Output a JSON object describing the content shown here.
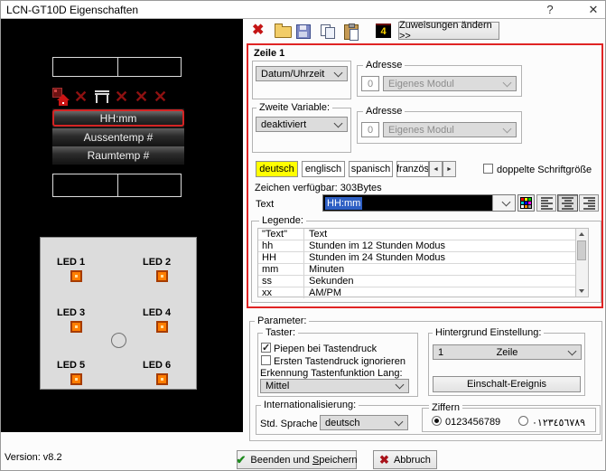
{
  "window": {
    "title": "LCN-GT10D Eigenschaften",
    "help_glyph": "?",
    "close_glyph": "✕"
  },
  "toolbar": {
    "four_label": "4",
    "assign_button": "Zuweisungen ändern >>",
    "icons": [
      "delete-icon",
      "open-icon",
      "save-icon",
      "copy-icon",
      "paste-icon",
      "display-page-icon"
    ]
  },
  "preview": {
    "lines": [
      "HH:mm",
      "Aussentemp #",
      "Raumtemp #"
    ],
    "selected_line": "HH:mm",
    "icons": [
      "module-home-icon",
      "cross-icon",
      "table-icon",
      "cross-icon",
      "cross-icon",
      "cross-icon"
    ],
    "leds": [
      "LED 1",
      "LED 2",
      "LED 3",
      "LED 4",
      "LED 5",
      "LED 6"
    ]
  },
  "zeile1": {
    "title": "Zeile 1",
    "variable1": "Datum/Uhrzeit",
    "adresse1": {
      "label": "Adresse",
      "id": "0",
      "module": "Eigenes Modul"
    },
    "zweite_variable_label": "Zweite Variable:",
    "variable2": "deaktiviert",
    "adresse2": {
      "label": "Adresse",
      "id": "0",
      "module": "Eigenes Modul"
    },
    "tabs": [
      "deutsch",
      "englisch",
      "spanisch",
      "französ"
    ],
    "active_tab": "deutsch",
    "tab_scroll_left": "◄",
    "tab_scroll_right": "►",
    "double_size_label": "doppelte Schriftgröße",
    "double_size_checked": false,
    "chars_available": "Zeichen verfügbar: 303Bytes",
    "text_label": "Text",
    "text_value": "HH:mm",
    "legend": {
      "title": "Legende:",
      "rows": [
        [
          "\"Text\"",
          "Text"
        ],
        [
          "hh",
          "Stunden im 12 Stunden Modus"
        ],
        [
          "HH",
          "Stunden im 24 Stunden Modus"
        ],
        [
          "mm",
          "Minuten"
        ],
        [
          "ss",
          "Sekunden"
        ],
        [
          "xx",
          "AM/PM"
        ]
      ]
    }
  },
  "parameter": {
    "title": "Parameter:",
    "taster": {
      "title": "Taster:",
      "beep_label": "Piepen bei Tastendruck",
      "beep_checked": true,
      "ignore_label": "Ersten Tastendruck ignorieren",
      "ignore_checked": false,
      "longpress_label": "Erkennung Tastenfunktion Lang:",
      "longpress_value": "Mittel"
    },
    "hintergrund": {
      "title": "Hintergrund Einstellung:",
      "value_num": "1",
      "value_text": "Zeile",
      "event_button": "Einschalt-Ereignis"
    },
    "intl": {
      "title": "Internationalisierung:",
      "language_label": "Std. Sprache",
      "language_value": "deutsch",
      "ziffern": {
        "title": "Ziffern",
        "latin": "0123456789",
        "arabic": "٠١٢٣٤٥٦٧٨٩",
        "selected": "latin"
      }
    }
  },
  "footer": {
    "version": "Version: v8.2",
    "save_part1": "Beenden und ",
    "save_part2": "S",
    "save_part3": "peichern",
    "cancel": "Abbruch"
  },
  "colors": {
    "highlight_border": "#e02424",
    "active_tab": "#ffff00",
    "selection": "#2e5fc4",
    "led": "#ff7e00",
    "save_check": "#1d8a1d",
    "cancel_x": "#a8121a"
  }
}
